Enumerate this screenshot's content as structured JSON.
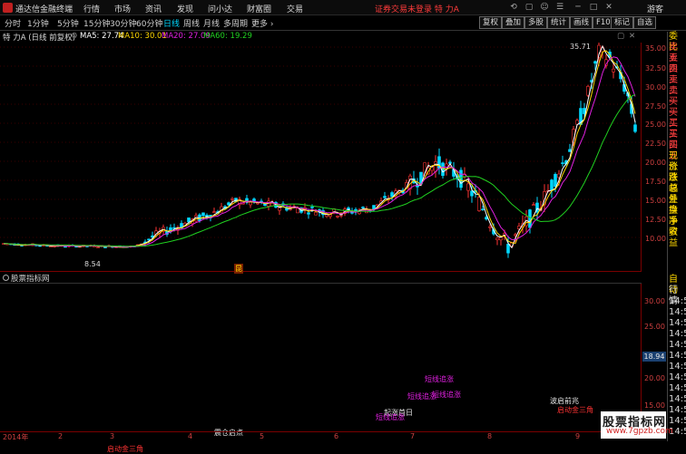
{
  "window": {
    "app_title": "通达信金融终端",
    "menus": [
      "行情",
      "市场",
      "资讯",
      "发现",
      "问小达",
      "财富圈",
      "交易"
    ],
    "login_status": "证券交易未登录",
    "stock_title": "特 力A",
    "visitor": "游客"
  },
  "timeframes": [
    "分时",
    "1分钟",
    "5分钟",
    "15分钟",
    "30分钟",
    "60分钟",
    "日线",
    "周线",
    "月线",
    "多周期",
    "更多"
  ],
  "active_timeframe": "日线",
  "right_buttons": [
    "复权",
    "叠加",
    "多股",
    "统计",
    "画线",
    "F10",
    "标记",
    "自选"
  ],
  "info": {
    "stock": "特 力A (日线 前复权)",
    "ma5": "MA5: 27.74",
    "ma10": "MA10: 30.01",
    "ma20": "MA20: 27.09",
    "ma60": "MA60: 19.29"
  },
  "price_axis": [
    "35.00",
    "32.50",
    "30.00",
    "27.50",
    "25.00",
    "22.50",
    "20.00",
    "17.50",
    "15.00",
    "12.50",
    "10.00"
  ],
  "annotations": {
    "high": "35.71",
    "low": "8.54",
    "marker": "昆"
  },
  "side_labels": [
    "委比",
    "卖五",
    "卖四",
    "卖三",
    "卖二",
    "卖一",
    "买一",
    "买二",
    "买三",
    "买四",
    "买五",
    "现价",
    "涨跌",
    "涨幅",
    "总量",
    "外盘",
    "换手",
    "净资",
    "收益",
    "自动",
    "行情",
    "14:5",
    "14:5",
    "14:5",
    "14:5",
    "14:5",
    "14:5",
    "14:5",
    "14:5",
    "14:5",
    "14:5",
    "14:5",
    "14:5",
    "14:5"
  ],
  "indicator": {
    "title": "股票指标网",
    "axis": [
      "30.00",
      "25.00",
      "20.00",
      "15.00"
    ],
    "current": "18.94"
  },
  "signals": [
    "短线追涨",
    "短线追涨",
    "短线追涨",
    "起涨首日",
    "短线追涨",
    "震仓启点",
    "启动金三角",
    "波启前兆",
    "启动金三角"
  ],
  "date_labels": [
    "2014年",
    "2",
    "3",
    "4",
    "5",
    "6",
    "7",
    "8",
    "9"
  ],
  "watermark": {
    "name": "股票指标网",
    "url": "www.7gpzb.com"
  },
  "chart_data": {
    "type": "candlestick",
    "y_axis_ticks": [
      35,
      32.5,
      30,
      27.5,
      25,
      22.5,
      20,
      17.5,
      15,
      12.5,
      10
    ],
    "high": 35.71,
    "low": 8.54,
    "ma_values": {
      "MA5": 27.74,
      "MA10": 30.01,
      "MA20": 27.09,
      "MA60": 19.29
    }
  },
  "colors": {
    "up": "#ff3333",
    "down": "#00d8ff",
    "ma5": "#ffffff",
    "ma10": "#ffd800",
    "ma20": "#e020e0",
    "ma60": "#20d020"
  }
}
